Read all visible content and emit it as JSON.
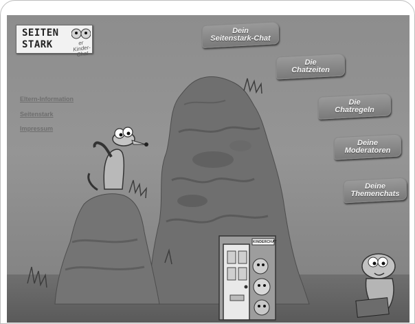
{
  "logo": {
    "line1": "SEITEN",
    "line2": "STARK",
    "subtitle": "er Kinder-Chat"
  },
  "side_links": [
    {
      "label": "Eltern-Information"
    },
    {
      "label": "Seitenstark"
    },
    {
      "label": "Impressum"
    }
  ],
  "signs": [
    {
      "line1": "Dein",
      "line2": "Seitenstark-Chat"
    },
    {
      "line1": "Die",
      "line2": "Chatzeiten"
    },
    {
      "line1": "Die",
      "line2": "Chatregeln"
    },
    {
      "line1": "Deine",
      "line2": "Moderatoren"
    },
    {
      "line1": "Deine",
      "line2": "Themenchats"
    }
  ],
  "door": {
    "sign_text": "KINDERCHAT"
  },
  "colors": {
    "sky": "#919191",
    "rock": "#7a7a7a",
    "sign": "#8c8c8c",
    "link": "#6e6e6e"
  },
  "icons": [
    "meerkat-waving",
    "meerkat-reading",
    "door",
    "grass"
  ]
}
